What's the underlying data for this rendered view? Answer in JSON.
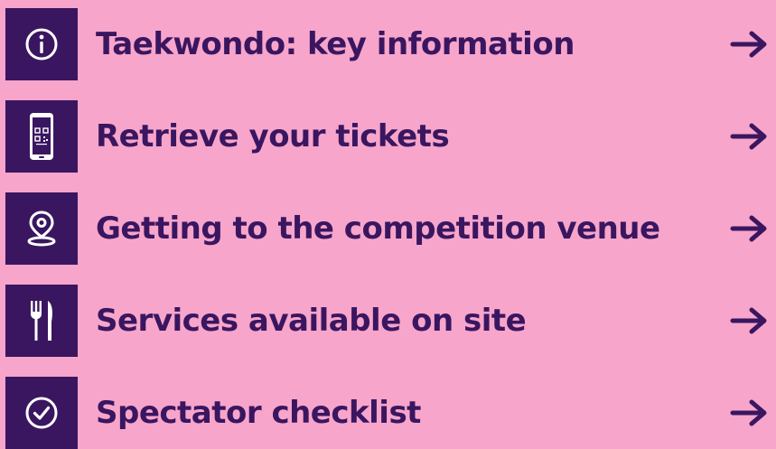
{
  "colors": {
    "background": "#F8A5CB",
    "accent": "#3A1660",
    "icon_fg": "#FFFFFF"
  },
  "menu": {
    "items": [
      {
        "label": "Taekwondo: key information",
        "icon": "info-icon"
      },
      {
        "label": "Retrieve your tickets",
        "icon": "smartphone-qr-icon"
      },
      {
        "label": "Getting to the competition venue",
        "icon": "map-pin-icon"
      },
      {
        "label": "Services available on site",
        "icon": "fork-knife-icon"
      },
      {
        "label": "Spectator checklist",
        "icon": "checkmark-circle-icon"
      }
    ],
    "arrow_icon": "arrow-right-icon"
  }
}
